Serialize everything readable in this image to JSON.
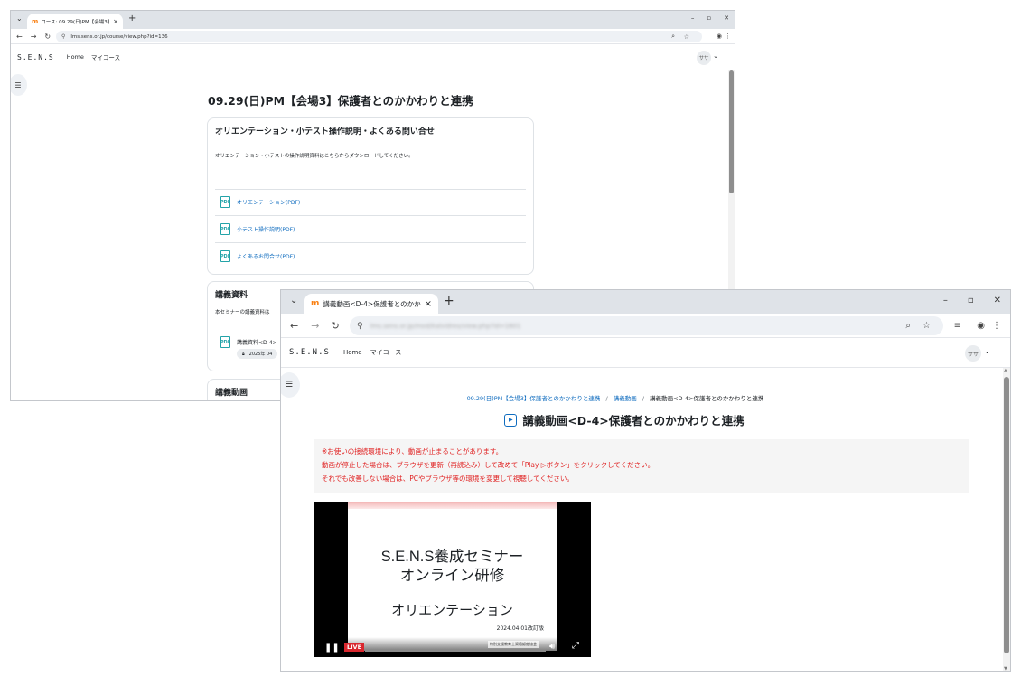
{
  "window1": {
    "tab_favicon": "m",
    "tab_title": "コース: 09.29(日)PM【会場3】保護",
    "tab_close": "×",
    "new_tab": "+",
    "win_controls": [
      "–",
      "▫",
      "✕"
    ],
    "url": "lms.sens.or.jp/course/view.php?id=136",
    "site": {
      "brand": "S.E.N.S",
      "nav": [
        "Home",
        "マイコース"
      ],
      "avatar": "ササ",
      "caret": "⌄"
    },
    "page_title": "09.29(日)PM【会場3】保護者とのかかわりと連携",
    "orientation": {
      "heading": "オリエンテーション・小テスト操作説明・よくある問い合せ",
      "description": "オリエンテーション・小テストの操作説明資料はこちらからダウンロードしてください。",
      "links": [
        "オリエンテーション(PDF)",
        "小テスト操作説明(PDF)",
        "よくあるお問合せ(PDF)"
      ],
      "pdf_icon_text": "PDF"
    },
    "materials": {
      "heading": "講義資料",
      "description": "本セミナーの講義資料は",
      "item_label": "講義資料<D-4>",
      "restriction": "2025年 04"
    },
    "video_section": {
      "heading": "講義動画"
    }
  },
  "window2": {
    "tab_favicon": "m",
    "tab_title": "講義動画<D-4>保護者とのかかわ",
    "tab_close": "×",
    "new_tab": "+",
    "win_controls": [
      "–",
      "▫",
      "✕"
    ],
    "url": "lms.sens.or.jp/mod/kalvidres/view.php?id=1601",
    "site": {
      "brand": "S.E.N.S",
      "nav": [
        "Home",
        "マイコース"
      ],
      "avatar": "ササ",
      "caret": "⌄"
    },
    "breadcrumb": {
      "course": "09.29(日)PM【会場3】保護者とのかかわりと連携",
      "section": "講義動画",
      "current": "講義動画<D-4>保護者とのかかわりと連携",
      "separator": "/"
    },
    "page_title": "講義動画<D-4>保護者とのかかわりと連携",
    "notice": [
      "※お使いの接続環境により、動画が止まることがあります。",
      "動画が停止した場合は、ブラウザを更新（再読込み）して改めて「Play ▷ボタン」をクリックしてください。",
      "それでも改善しない場合は、PCやブラウザ等の環境を変更して視聴してください。"
    ],
    "video": {
      "slide_title_1": "S.E.N.S養成セミナー",
      "slide_title_2": "オンライン研修",
      "slide_subtitle": "オリエンテーション",
      "slide_date": "2024.04.01改訂版",
      "live_badge": "LIVE",
      "org_mark": "特別支援教育士資格認定協会",
      "progress": 0.0
    }
  },
  "colors": {
    "accent": "#0f6cbf",
    "notice_text": "#e02020",
    "notice_bg": "#f5f5f5",
    "live_red": "#d9272e"
  }
}
